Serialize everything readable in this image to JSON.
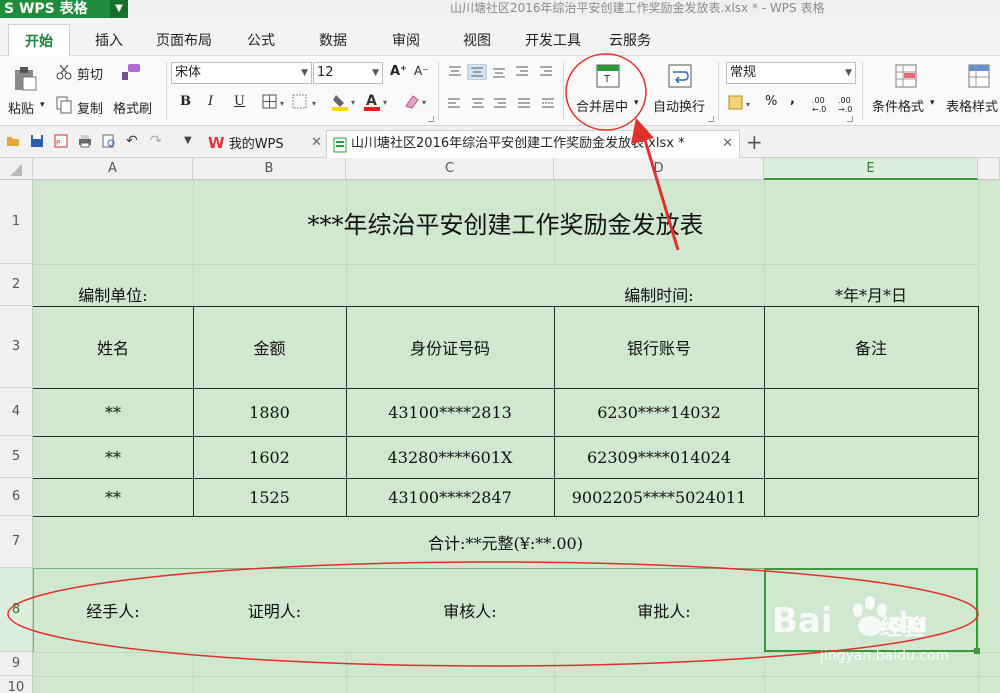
{
  "app": {
    "name": "S WPS 表格",
    "window_title": "山川塘社区2016年综治平安创建工作奖励金发放表.xlsx * - WPS 表格"
  },
  "menu": {
    "tabs": [
      "开始",
      "插入",
      "页面布局",
      "公式",
      "数据",
      "审阅",
      "视图",
      "开发工具",
      "云服务"
    ]
  },
  "ribbon": {
    "paste": "粘贴",
    "cut": "剪切",
    "copy": "复制",
    "format_painter": "格式刷",
    "font_name": "宋体",
    "font_size": "12",
    "merge_center": "合并居中",
    "wrap_text": "自动换行",
    "number_format": "常规",
    "conditional_format": "条件格式",
    "table_style": "表格样式",
    "bold": "B",
    "italic": "I",
    "underline": "U",
    "font_color_letter": "A",
    "percent": "%",
    "comma": ",",
    "grow_font": "A⁺",
    "shrink_font": "A⁻",
    "inc_decimal": ".00 ←.0",
    "dec_decimal": ".00 →.0"
  },
  "doc_tabs": {
    "home": "我的WPS",
    "file": "山川塘社区2016年综治平安创建工作奖励金发放表.xlsx *"
  },
  "sheet": {
    "columns": [
      "A",
      "B",
      "C",
      "D",
      "E"
    ],
    "rows": [
      "1",
      "2",
      "3",
      "4",
      "5",
      "6",
      "7",
      "8",
      "9",
      "10"
    ],
    "title": "***年综治平安创建工作奖励金发放表",
    "unit_label": "编制单位:",
    "time_label": "编制时间:",
    "time_value": "*年*月*日",
    "headers": [
      "姓名",
      "金额",
      "身份证号码",
      "银行账号",
      "备注"
    ],
    "data_rows": [
      [
        "**",
        "1880",
        "43100****2813",
        "6230****14032",
        ""
      ],
      [
        "**",
        "1602",
        "43280****601X",
        "62309****014024",
        ""
      ],
      [
        "**",
        "1525",
        "43100****2847",
        "9002205****5024011",
        ""
      ]
    ],
    "total": "合计:**元整(¥:**.00)",
    "signatures": [
      "经手人:",
      "证明人:",
      "审核人:",
      "审批人:"
    ]
  },
  "watermark": {
    "brand": "Bai du 经验",
    "url": "jingyan.baidu.com"
  },
  "colors": {
    "accent_green": "#1e8c3a",
    "sheet_bg": "#cfe8cf",
    "annotation_red": "#e0302d"
  }
}
